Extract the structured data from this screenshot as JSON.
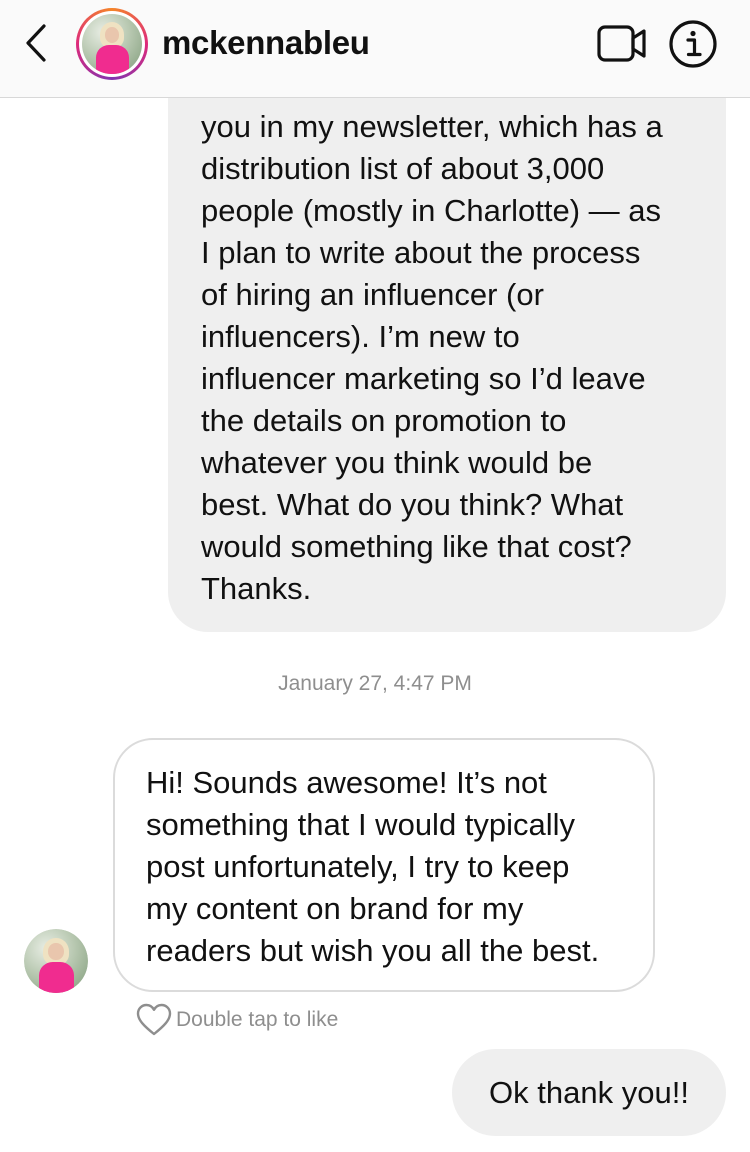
{
  "header": {
    "username": "mckennableu",
    "back_icon": "chevron-left-icon",
    "video_icon": "video-camera-icon",
    "info_icon": "info-icon"
  },
  "messages": {
    "outgoing_long": {
      "lines": [
        "you in my newsletter, which has a",
        "distribution list of about 3,000",
        "people (mostly in Charlotte) — as",
        "I plan to write about the process",
        "of hiring an influencer (or",
        "influencers). I’m new to",
        "influencer marketing so I’d leave",
        "the details on promotion to",
        "whatever you think would be",
        "best. What do you think? What",
        "would something like that cost?",
        "Thanks."
      ]
    },
    "timestamp": "January 27, 4:47 PM",
    "incoming": {
      "lines": [
        "Hi! Sounds awesome! It’s not",
        "something that I would typically",
        "post unfortunately, I try to keep",
        "my content on brand for my",
        "readers but wish you all the best."
      ],
      "like_hint": "Double tap to like",
      "like_icon": "heart-outline-icon"
    },
    "outgoing_short": {
      "text": "Ok thank you!!"
    }
  },
  "colors": {
    "outgoing_bubble": "#efefef",
    "incoming_border": "#dbdbdb",
    "meta_text": "#8e8e8e",
    "avatar_ring_start": "#f58529",
    "avatar_ring_end": "#dd2a7b",
    "dress_pink": "#f02c8f"
  }
}
